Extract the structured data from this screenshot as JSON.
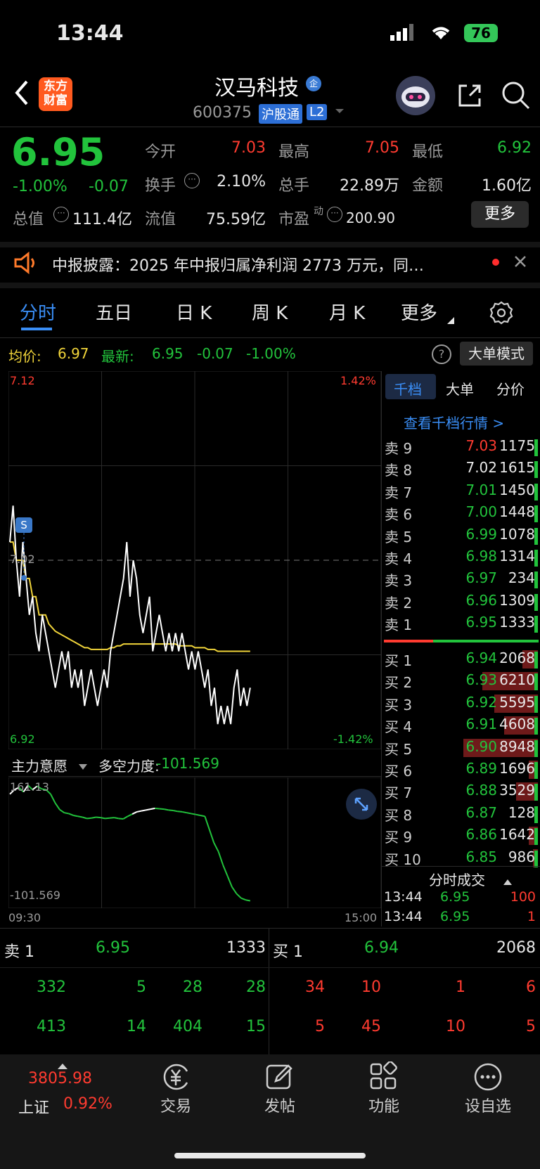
{
  "status": {
    "time": "13:44",
    "battery": "76"
  },
  "header": {
    "back_icon": "chevron-left-icon",
    "logo": "东方\n财富",
    "logo_line1": "东方",
    "logo_line2": "财富",
    "title": "汉马科技",
    "badge_qi": "企",
    "code": "600375",
    "tag_hgt": "沪股通",
    "tag_l2": "L2"
  },
  "quote": {
    "price": "6.95",
    "pct": "-1.00%",
    "chg": "-0.07",
    "open_label": "今开",
    "open": "7.03",
    "high_label": "最高",
    "high": "7.05",
    "low_label": "最低",
    "low": "6.92",
    "turnover_label": "换手",
    "turnover": "2.10%",
    "vol_label": "总手",
    "vol": "22.89万",
    "amount_label": "金额",
    "amount": "1.60亿",
    "mcap_label": "总值",
    "mcap": "111.4亿",
    "float_label": "流值",
    "float": "75.59亿",
    "pe_label": "市盈",
    "pe_sup": "动",
    "pe": "200.90",
    "more_btn": "更多"
  },
  "notice": {
    "text": "中报披露：2025 年中报归属净利润 2773 万元，同…"
  },
  "tabs": [
    "分时",
    "五日",
    "日 K",
    "周 K",
    "月 K",
    "更多"
  ],
  "chart_info": {
    "avg_label": "均价:",
    "avg": "6.97",
    "last_label": "最新:",
    "last": "6.95",
    "last_chg": "-0.07",
    "last_pct": "-1.00%",
    "mode_btn": "大单模式"
  },
  "chart_data": {
    "type": "line",
    "y_top": "7.12",
    "y_mid": "7.02",
    "y_bottom": "6.92",
    "pct_top": "1.42%",
    "pct_bottom": "-1.42%",
    "x_start": "09:30",
    "x_end": "15:00",
    "marker": "S",
    "ylim": [
      6.92,
      7.12
    ],
    "price": [
      7.03,
      7.05,
      7.02,
      7.0,
      7.03,
      7.01,
      6.99,
      7.0,
      6.98,
      6.97,
      6.99,
      6.98,
      6.97,
      6.96,
      6.95,
      6.96,
      6.97,
      6.96,
      6.97,
      6.95,
      6.96,
      6.95,
      6.96,
      6.94,
      6.95,
      6.96,
      6.95,
      6.94,
      6.95,
      6.96,
      6.95,
      6.97,
      6.98,
      6.99,
      7.0,
      7.01,
      7.03,
      7.0,
      7.02,
      7.01,
      6.99,
      6.98,
      6.99,
      7.0,
      6.97,
      6.98,
      6.99,
      6.98,
      6.97,
      6.98,
      6.97,
      6.98,
      6.97,
      6.98,
      6.97,
      6.96,
      6.97,
      6.96,
      6.97,
      6.96,
      6.95,
      6.96,
      6.94,
      6.95,
      6.93,
      6.94,
      6.93,
      6.94,
      6.93,
      6.95,
      6.96,
      6.94,
      6.95,
      6.94,
      6.95
    ],
    "avg": [
      7.03,
      7.03,
      7.02,
      7.02,
      7.02,
      7.01,
      7.01,
      7.0,
      7.0,
      6.99,
      6.99,
      6.99,
      6.985,
      6.983,
      6.981,
      6.98,
      6.979,
      6.978,
      6.977,
      6.976,
      6.975,
      6.974,
      6.973,
      6.972,
      6.972,
      6.971,
      6.971,
      6.971,
      6.971,
      6.971,
      6.971,
      6.972,
      6.972,
      6.973,
      6.973,
      6.974,
      6.974,
      6.974,
      6.974,
      6.974,
      6.974,
      6.974,
      6.974,
      6.974,
      6.974,
      6.974,
      6.974,
      6.974,
      6.974,
      6.974,
      6.974,
      6.974,
      6.973,
      6.973,
      6.973,
      6.973,
      6.973,
      6.972,
      6.972,
      6.972,
      6.972,
      6.971,
      6.971,
      6.971,
      6.97,
      6.97,
      6.97,
      6.97,
      6.97,
      6.97,
      6.97,
      6.97,
      6.97,
      6.97,
      6.97
    ],
    "flow_top": "161.13",
    "flow_bottom": "-101.569",
    "flow": [
      140,
      150,
      155,
      145,
      160,
      150,
      158,
      152,
      150,
      140,
      120,
      105,
      98,
      96,
      92,
      90,
      88,
      85,
      86,
      88,
      87,
      85,
      86,
      87,
      85,
      84,
      90,
      95,
      100,
      102,
      104,
      106,
      108,
      107,
      106,
      104,
      103,
      101,
      100,
      98,
      96,
      94,
      92,
      90,
      60,
      30,
      10,
      -20,
      -45,
      -70,
      -85,
      -95,
      -99,
      -101
    ]
  },
  "flow_panel": {
    "label": "主力意愿",
    "power_label": "多空力度:",
    "power": "-101.569"
  },
  "side": {
    "tab1": "千档",
    "tab2": "大单",
    "tab3": "分价",
    "link": "查看千档行情 >",
    "asks": [
      {
        "label": "卖 9",
        "price": "7.03",
        "vol": "1175",
        "color": "red"
      },
      {
        "label": "卖 8",
        "price": "7.02",
        "vol": "1615",
        "color": "wht"
      },
      {
        "label": "卖 7",
        "price": "7.01",
        "vol": "1450",
        "color": "grn"
      },
      {
        "label": "卖 6",
        "price": "7.00",
        "vol": "1448",
        "color": "grn"
      },
      {
        "label": "卖 5",
        "price": "6.99",
        "vol": "1078",
        "color": "grn"
      },
      {
        "label": "卖 4",
        "price": "6.98",
        "vol": "1314",
        "color": "grn"
      },
      {
        "label": "卖 3",
        "price": "6.97",
        "vol": "234",
        "color": "grn"
      },
      {
        "label": "卖 2",
        "price": "6.96",
        "vol": "1309",
        "color": "grn"
      },
      {
        "label": "卖 1",
        "price": "6.95",
        "vol": "1333",
        "color": "grn"
      }
    ],
    "bids": [
      {
        "label": "买 1",
        "price": "6.94",
        "vol": "2068",
        "bar": 0.1
      },
      {
        "label": "买 2",
        "price": "6.93",
        "vol": "6210",
        "bar": 0.36
      },
      {
        "label": "买 3",
        "price": "6.92",
        "vol": "5595",
        "bar": 0.28
      },
      {
        "label": "买 4",
        "price": "6.91",
        "vol": "4608",
        "bar": 0.22
      },
      {
        "label": "买 5",
        "price": "6.90",
        "vol": "8948",
        "bar": 0.48
      },
      {
        "label": "买 6",
        "price": "6.89",
        "vol": "1696",
        "bar": 0.06
      },
      {
        "label": "买 7",
        "price": "6.88",
        "vol": "3529",
        "bar": 0.14
      },
      {
        "label": "买 8",
        "price": "6.87",
        "vol": "128",
        "bar": 0.0
      },
      {
        "label": "买 9",
        "price": "6.86",
        "vol": "1642",
        "bar": 0.06
      },
      {
        "label": "买 10",
        "price": "6.85",
        "vol": "986",
        "bar": 0.03
      }
    ],
    "ticks_label": "分时成交",
    "ticks": [
      {
        "time": "13:44",
        "price": "6.95",
        "vol": "100"
      },
      {
        "time": "13:44",
        "price": "6.95",
        "vol": "1"
      }
    ]
  },
  "queue": {
    "sell_label": "卖 1",
    "sell_price": "6.95",
    "sell_vol": "1333",
    "buy_label": "买 1",
    "buy_price": "6.94",
    "buy_vol": "2068",
    "sell_rows": [
      [
        "332",
        "5",
        "28",
        "28"
      ],
      [
        "413",
        "14",
        "404",
        "15"
      ]
    ],
    "buy_rows": [
      [
        "34",
        "10",
        "1",
        "6"
      ],
      [
        "5",
        "45",
        "10",
        "5"
      ]
    ]
  },
  "bottom": {
    "index_value": "3805.98",
    "index_name": "上证",
    "index_pct": "0.92%",
    "nav": [
      "交易",
      "发帖",
      "功能",
      "设自选"
    ]
  }
}
